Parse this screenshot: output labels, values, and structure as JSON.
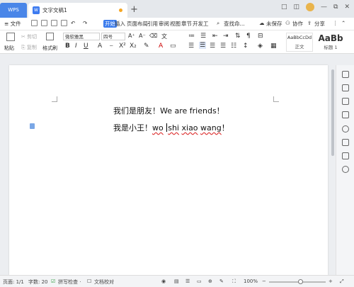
{
  "titlebar": {
    "app_tab": "WPS",
    "doc_tab": "文字文稿1",
    "add_tab": "+",
    "window_controls": [
      "□",
      "◫",
      "—",
      "⧉",
      "✕"
    ]
  },
  "menubar": {
    "file": "≡ 文件",
    "tabs": [
      "开始",
      "插入",
      "页面布局",
      "引用",
      "审阅",
      "视图",
      "章节",
      "开发工"
    ],
    "search": "查找命...",
    "unsaved": "未保存",
    "collab": "协作",
    "share": "分享"
  },
  "ribbon": {
    "paste": "粘贴",
    "cut": "剪切",
    "copy": "复制",
    "format_painter": "格式刷",
    "font_name": "微软雅黑",
    "font_size": "四号",
    "style_normal_sample": "AaBbCcDd",
    "style_normal": "正文",
    "style_h1_sample": "AaBb",
    "style_h1": "标题 1"
  },
  "document": {
    "line1": "我们是朋友！We are friends！",
    "line2_a": "我是小王！",
    "line2_b": "wo",
    "line2_c": "shi",
    "line2_d": "xiao",
    "line2_e": "wang",
    "line2_f": "！"
  },
  "statusbar": {
    "page": "页面: 1/1",
    "words": "字数: 20",
    "spell": "拼写检查 ·",
    "proof": "文档校对",
    "zoom": "100%"
  },
  "colors": {
    "accent": "#3a7bed",
    "wps_tab": "#4a86e8",
    "unsaved_dot": "#f5a623"
  }
}
